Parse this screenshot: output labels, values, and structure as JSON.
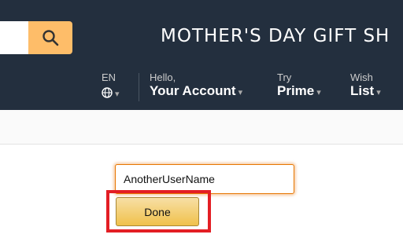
{
  "header": {
    "banner": "MOTHER'S DAY GIFT SH",
    "search_icon": "search-icon",
    "language": {
      "code": "EN",
      "icon": "globe-icon"
    },
    "account": {
      "line1": "Hello,",
      "line2": "Your Account"
    },
    "prime": {
      "line1": "Try",
      "line2": "Prime"
    },
    "wishlist": {
      "line1": "Wish",
      "line2": "List"
    }
  },
  "form": {
    "name_value": "AnotherUserName",
    "done_label": "Done"
  },
  "colors": {
    "header_bg": "#232f3e",
    "search_button": "#febd69",
    "button_gradient_top": "#f7dfa5",
    "button_gradient_bottom": "#f0c14b",
    "highlight": "#e31e24"
  }
}
